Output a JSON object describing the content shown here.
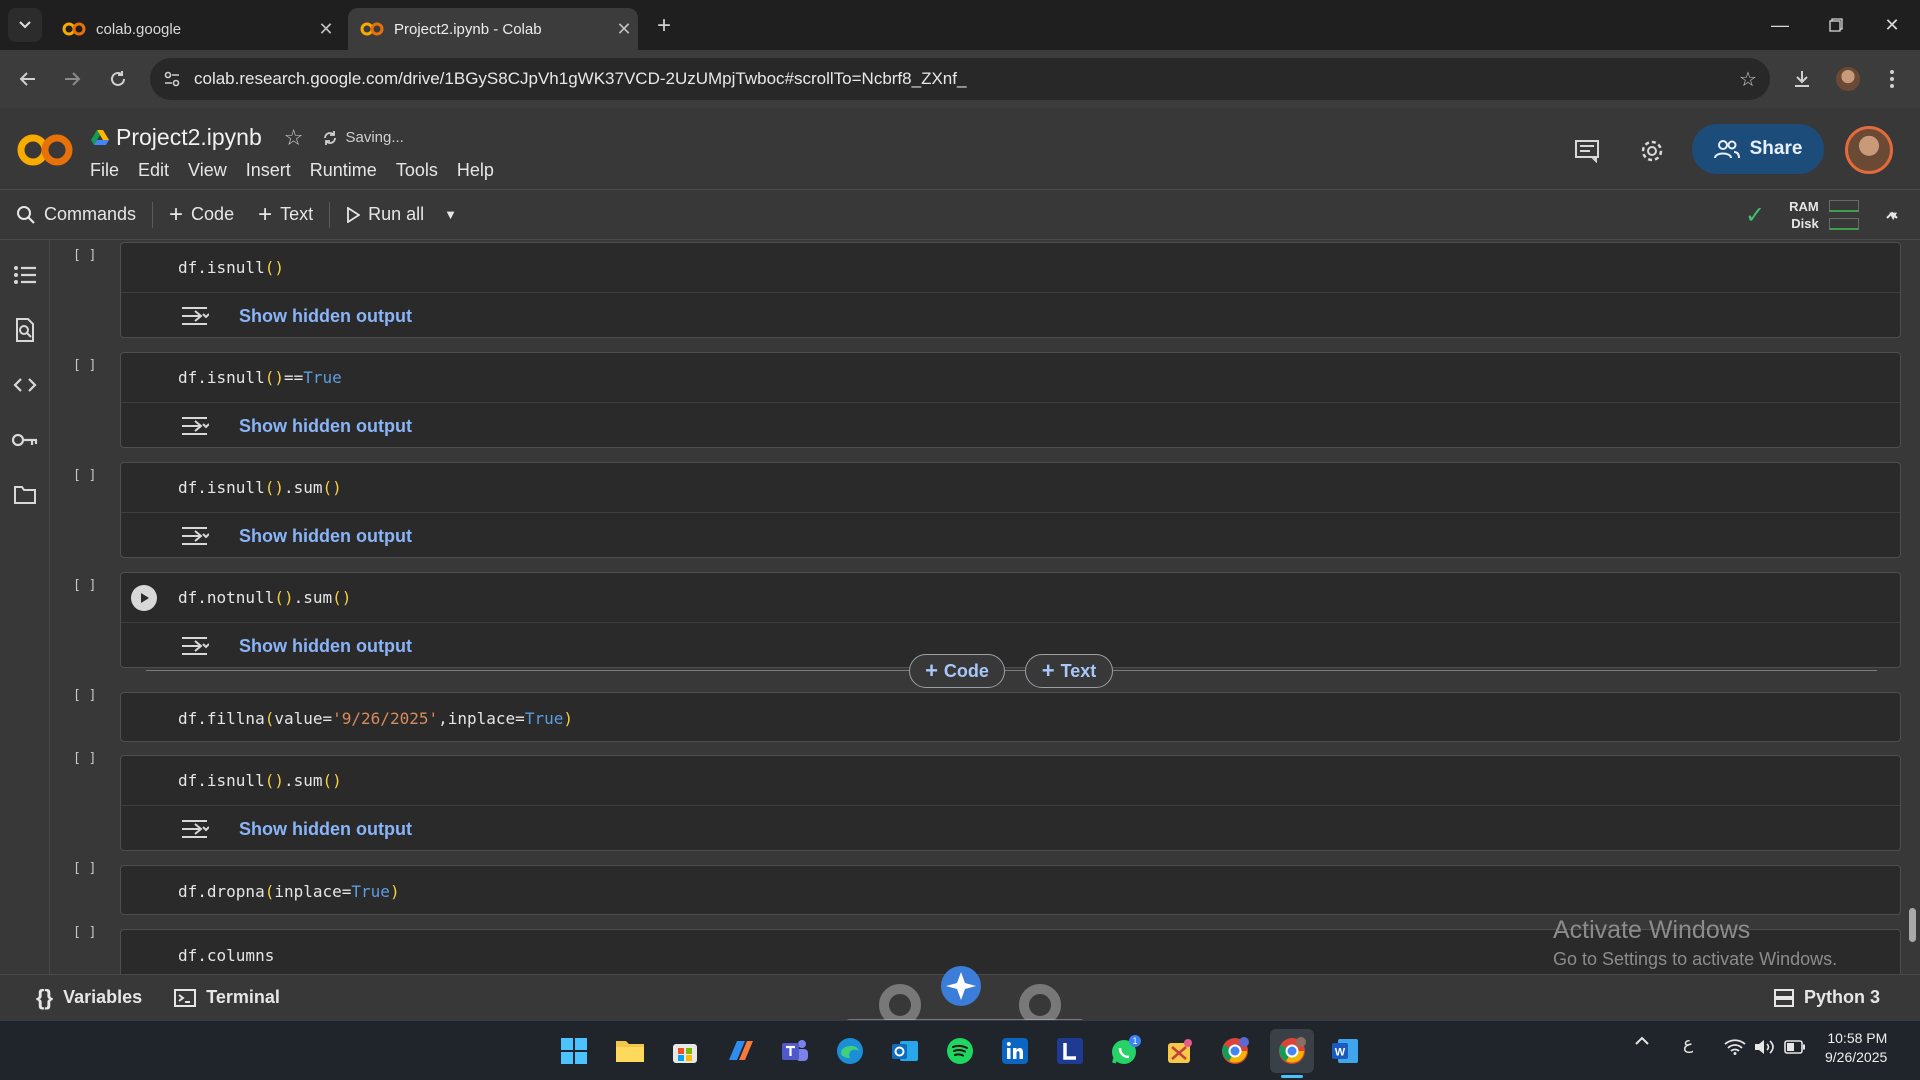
{
  "browser": {
    "tabs": [
      {
        "title": "colab.google",
        "active": false
      },
      {
        "title": "Project2.ipynb - Colab",
        "active": true
      }
    ],
    "url": "colab.research.google.com/drive/1BGyS8CJpVh1gWK37VCD-2UzUMpjTwboc#scrollTo=Ncbrf8_ZXnf_"
  },
  "colab": {
    "notebook_title": "Project2.ipynb",
    "saving_status": "Saving...",
    "menu": [
      "File",
      "Edit",
      "View",
      "Insert",
      "Runtime",
      "Tools",
      "Help"
    ],
    "share_label": "Share"
  },
  "toolbar": {
    "commands_label": "Commands",
    "code_label": "Code",
    "text_label": "Text",
    "run_all_label": "Run all",
    "ram_label": "RAM",
    "disk_label": "Disk"
  },
  "cells": [
    {
      "exec": "[ ]",
      "code": "df.isnull()",
      "output": "Show hidden output"
    },
    {
      "exec": "[ ]",
      "code": "df.isnull()==True",
      "output": "Show hidden output"
    },
    {
      "exec": "[ ]",
      "code": "df.isnull().sum()",
      "output": "Show hidden output"
    },
    {
      "exec": "[ ]",
      "code": "df.notnull().sum()",
      "output": "Show hidden output"
    },
    {
      "exec": "[ ]",
      "code": "df.fillna(value='9/26/2025',inplace=True)",
      "output": ""
    },
    {
      "exec": "[ ]",
      "code": "df.isnull().sum()",
      "output": "Show hidden output"
    },
    {
      "exec": "[ ]",
      "code": "df.dropna(inplace=True)",
      "output": ""
    },
    {
      "exec": "[ ]",
      "code": "df.columns",
      "output": ""
    }
  ],
  "add_cell": {
    "code": "Code",
    "text": "Text"
  },
  "watermark": {
    "line1": "Activate Windows",
    "line2": "Go to Settings to activate Windows."
  },
  "status": {
    "variables": "Variables",
    "terminal": "Terminal",
    "runtime": "Python 3"
  },
  "taskbar": {
    "time": "10:58 PM",
    "date": "9/26/2025",
    "language": "ع",
    "apps": [
      "windows-start",
      "file-explorer",
      "microsoft-store",
      "copilot",
      "teams",
      "edge",
      "outlook",
      "spotify",
      "linkedin",
      "l-app",
      "whatsapp",
      "snipping-tool",
      "chrome-profile",
      "chrome",
      "word"
    ]
  },
  "colors": {
    "accent": "#8ab4f8",
    "share_bg": "#1c4c7a",
    "colab_orange": "#f9ab00"
  }
}
